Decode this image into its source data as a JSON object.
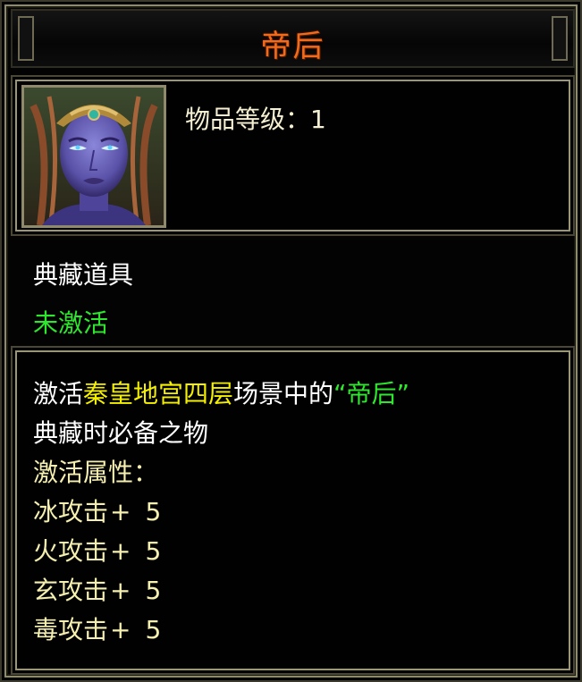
{
  "item": {
    "name": "帝后",
    "level_label": "物品等级：1",
    "type": "典藏道具",
    "status": "未激活",
    "portrait_icon": "empress-portrait-icon"
  },
  "description": {
    "prefix": "激活",
    "location": "秦皇地宫四层",
    "middle": "场景中的",
    "quoted_name": "“帝后”",
    "line2": "典藏时必备之物"
  },
  "attributes": {
    "title": "激活属性：",
    "list": [
      {
        "name": "冰攻击",
        "sign": "+",
        "value": "5"
      },
      {
        "name": "火攻击",
        "sign": "+",
        "value": "5"
      },
      {
        "name": "玄攻击",
        "sign": "+",
        "value": "5"
      },
      {
        "name": "毒攻击",
        "sign": "+",
        "value": "5"
      }
    ]
  },
  "colors": {
    "title": "#f26a1b",
    "status_green": "#2ee82e",
    "highlight_yellow": "#f4f000",
    "attribute_text": "#f5efb0",
    "frame": "#9b9676"
  }
}
